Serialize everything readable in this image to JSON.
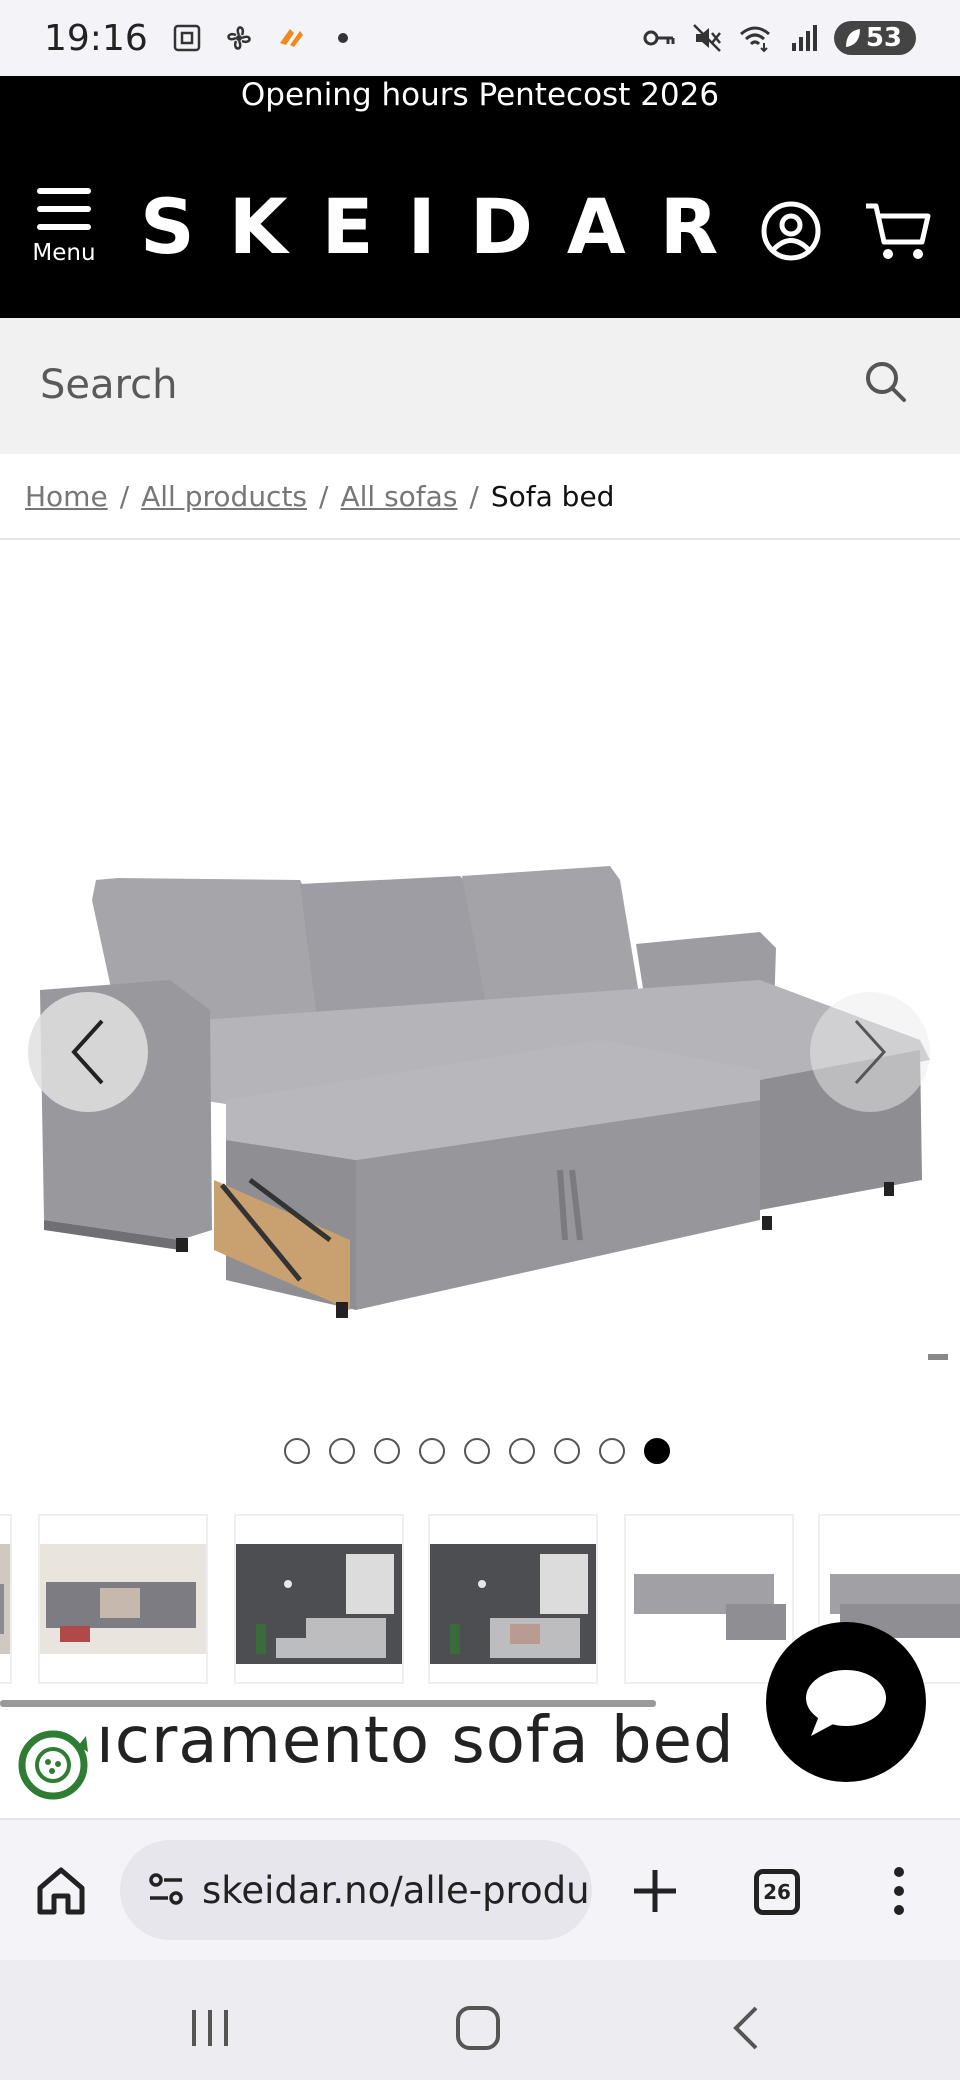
{
  "status_bar": {
    "time": "19:16",
    "battery": "53",
    "icons": [
      "screenshot-icon",
      "fan-icon",
      "app-badge-icon",
      "dot-icon",
      "key-icon",
      "mute-icon",
      "wifi-icon",
      "signal-icon",
      "battery-icon"
    ]
  },
  "header": {
    "announcement": "Opening hours Pentecost 2026",
    "menu_label": "Menu",
    "logo": "SKEIDAR"
  },
  "search": {
    "placeholder": "Search"
  },
  "breadcrumb": {
    "items": [
      "Home",
      "All products",
      "All sofas"
    ],
    "current": "Sofa bed",
    "separator": "/"
  },
  "gallery": {
    "dot_count": 9,
    "active_index": 8,
    "thumbnail_count": 6
  },
  "product": {
    "title": "ıcramento sofa bed"
  },
  "browser": {
    "url": "skeidar.no/alle-produ",
    "tab_count": "26"
  },
  "colors": {
    "brand_black": "#000000",
    "sofa_gray": "#9a9a9f",
    "accent_green": "#2e7d32"
  }
}
